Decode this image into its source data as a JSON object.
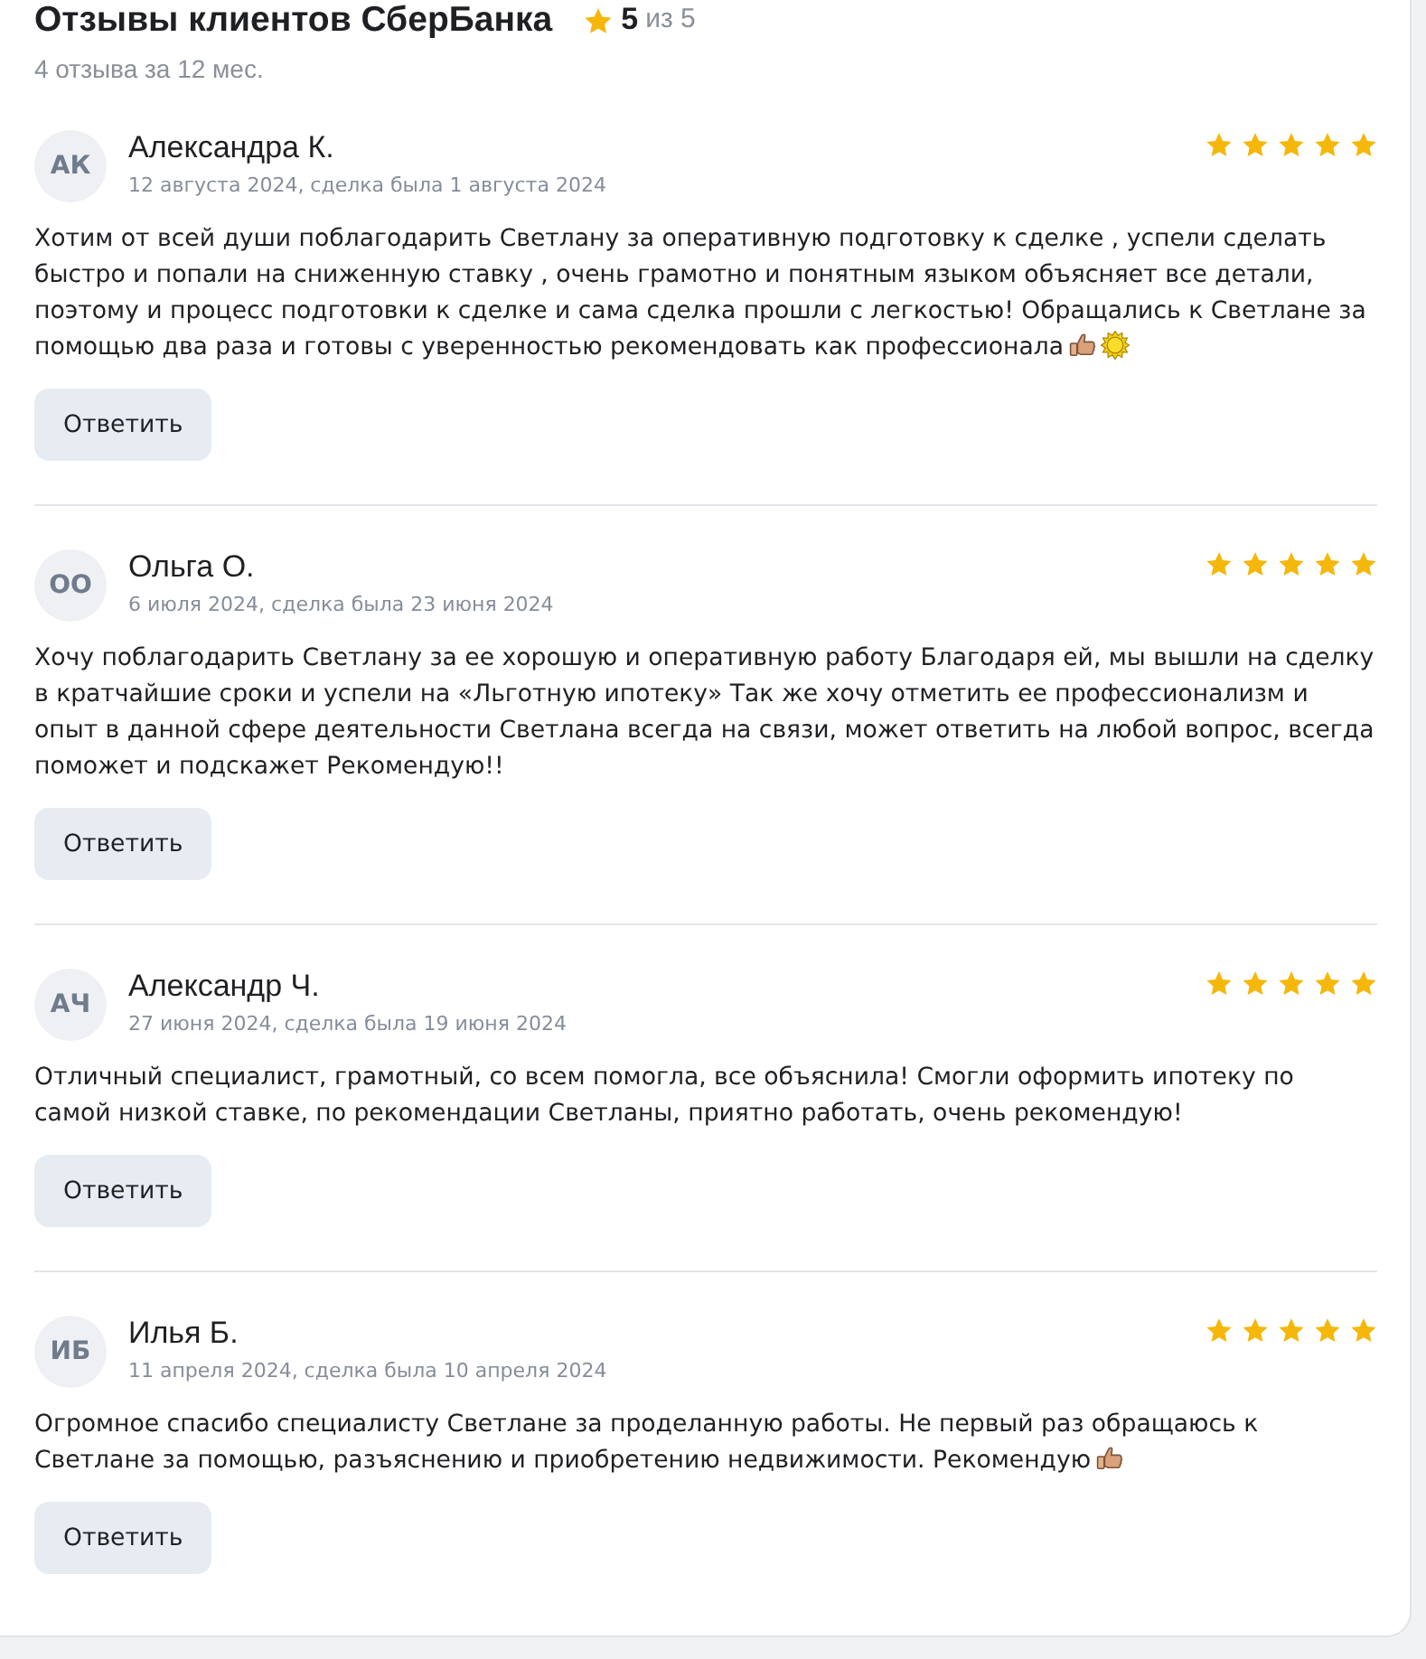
{
  "header": {
    "title": "Отзывы клиентов СберБанка",
    "rating": "5",
    "rating_scale": "из 5",
    "summary": "4 отзыва за 12 мес."
  },
  "reviews": [
    {
      "initials": "АК",
      "author": "Александра К.",
      "date": "12 августа 2024, сделка была 1 августа 2024",
      "stars": 5,
      "text": "Хотим от всей души поблагодарить Светлану за оперативную подготовку к сделке , успели сделать быстро и попали на сниженную ставку , очень грамотно и понятным языком объясняет все детали, поэтому и процесс подготовки к сделке и сама сделка прошли с легкостью! Обращались к Светлане за помощью два раза и готовы с уверенностью рекомендовать как профессионала",
      "emoji": [
        {
          "kind": "thumbs-up"
        },
        {
          "kind": "sun"
        }
      ],
      "reply_button": "Ответить"
    },
    {
      "initials": "ОО",
      "author": "Ольга О.",
      "date": "6 июля 2024, сделка была 23 июня 2024",
      "stars": 5,
      "text": "Хочу поблагодарить Светлану за ее хорошую и оперативную работу Благодаря ей, мы вышли на сделку в кратчайшие сроки и успели на «Льготную ипотеку» Так же хочу отметить ее профессионализм и опыт в данной сфере деятельности Светлана всегда на связи, может ответить на любой вопрос, всегда поможет и подскажет Рекомендую!!",
      "reply_button": "Ответить"
    },
    {
      "initials": "АЧ",
      "author": "Александр Ч.",
      "date": "27 июня 2024, сделка была 19 июня 2024",
      "stars": 5,
      "text": "Отличный специалист, грамотный, со всем помогла, все объяснила! Смогли оформить ипотеку по самой низкой ставке, по рекомендации Светланы, приятно работать, очень рекомендую!",
      "reply_button": "Ответить"
    },
    {
      "initials": "ИБ",
      "author": "Илья Б.",
      "date": "11 апреля 2024, сделка была 10 апреля 2024",
      "stars": 5,
      "text": "Огромное спасибо специалисту Светлане за проделанную работы. Не первый раз обращаюсь к Светлане за помощью, разъяснению и приобретению недвижимости. Рекомендую",
      "emoji": [
        {
          "kind": "thumbs-up"
        }
      ],
      "reply_button": "Ответить"
    }
  ]
}
